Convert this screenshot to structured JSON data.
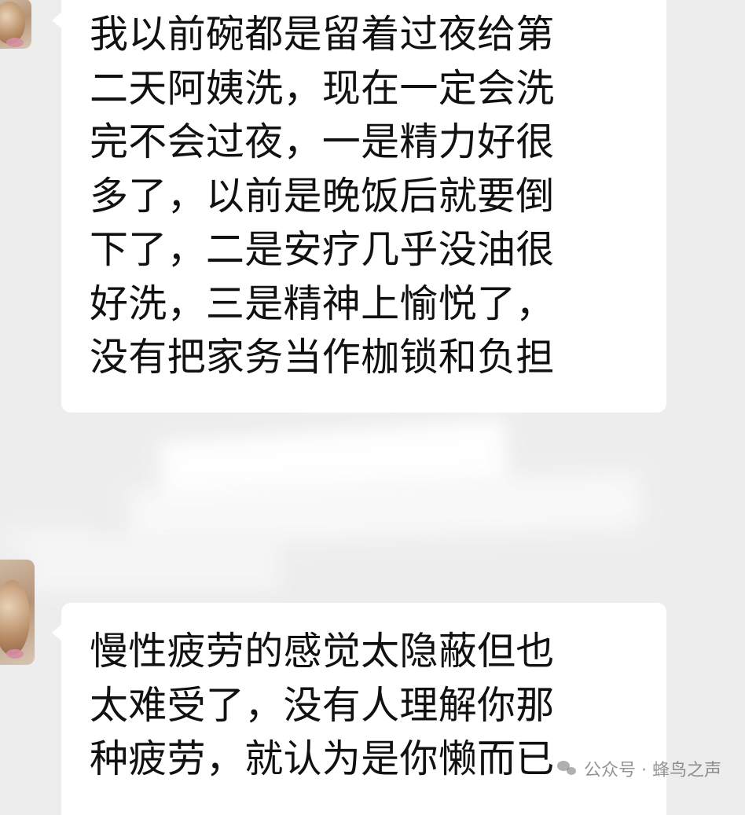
{
  "messages": [
    {
      "sender": "other",
      "text": "我以前碗都是留着过夜给第\n二天阿姨洗，现在一定会洗\n完不会过夜，一是精力好很\n多了，以前是晚饭后就要倒\n下了，二是安疗几乎没油很\n好洗，三是精神上愉悦了，\n没有把家务当作枷锁和负担"
    },
    {
      "sender": "other",
      "text": "慢性疲劳的感觉太隐蔽但也\n太难受了，没有人理解你那\n种疲劳，就认为是你懒而已"
    }
  ],
  "watermark": {
    "text": "公众号 · 蜂鸟之声",
    "icon": "wechat-icon"
  },
  "colors": {
    "background": "#ededed",
    "bubble": "#ffffff",
    "text": "#111111"
  }
}
